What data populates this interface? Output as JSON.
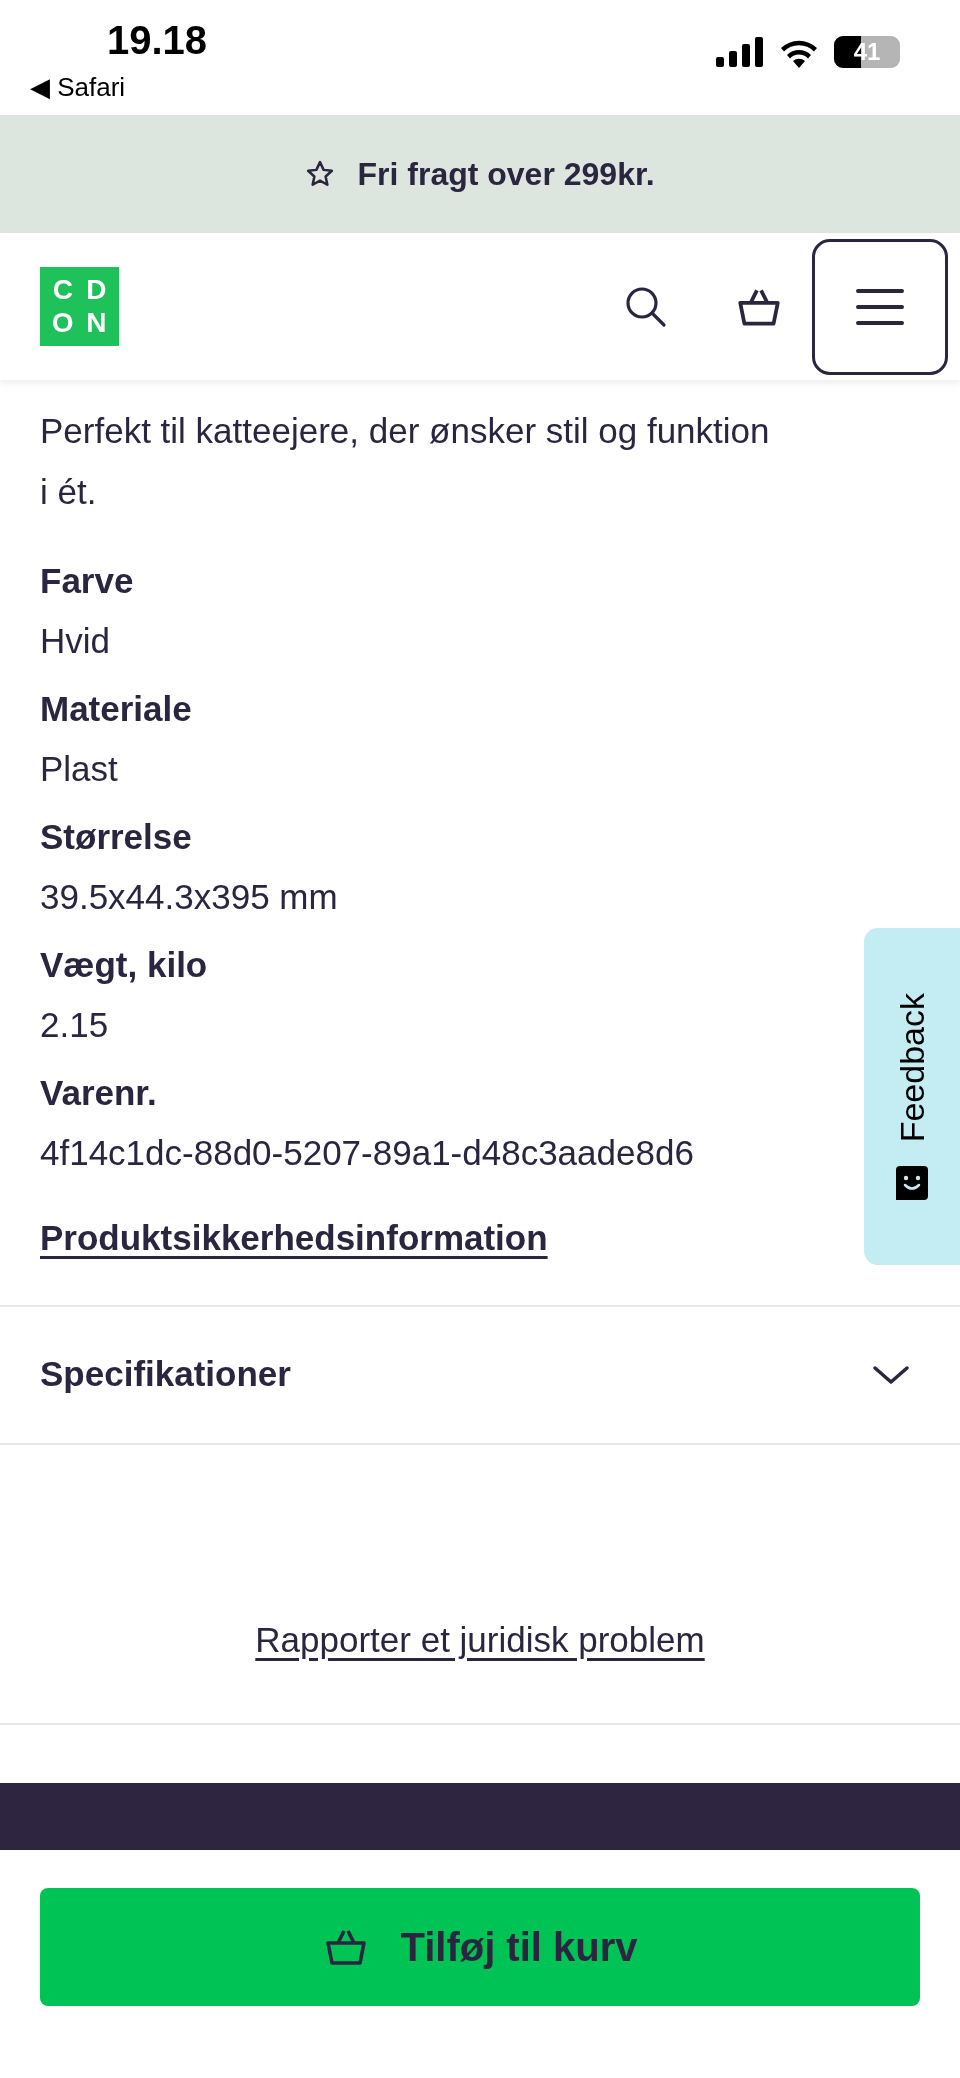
{
  "status_bar": {
    "time": "19.18",
    "back_label": "◀ Safari",
    "battery": "41"
  },
  "banner": {
    "text": "Fri fragt over 299kr."
  },
  "header": {
    "logo_letters": [
      "C",
      "D",
      "O",
      "N"
    ]
  },
  "description": {
    "lines": [
      "Perfekt til katteejere, der ønsker stil og funktion",
      "i ét."
    ]
  },
  "attributes": [
    {
      "label": "Farve",
      "value": "Hvid"
    },
    {
      "label": "Materiale",
      "value": "Plast"
    },
    {
      "label": "Størrelse",
      "value": "39.5x44.3x395 mm"
    },
    {
      "label": "Vægt, kilo",
      "value": "2.15"
    },
    {
      "label": "Varenr.",
      "value": "4f14c1dc-88d0-5207-89a1-d48c3aade8d6"
    }
  ],
  "safety_link": "Produktsikkerhedsinformation",
  "accordion": {
    "title": "Specifikationer",
    "expanded": false
  },
  "report_link": "Rapporter et juridisk problem",
  "feedback_tab": {
    "label": "Feedback"
  },
  "add_to_cart": {
    "label": "Tilføj til kurv"
  }
}
